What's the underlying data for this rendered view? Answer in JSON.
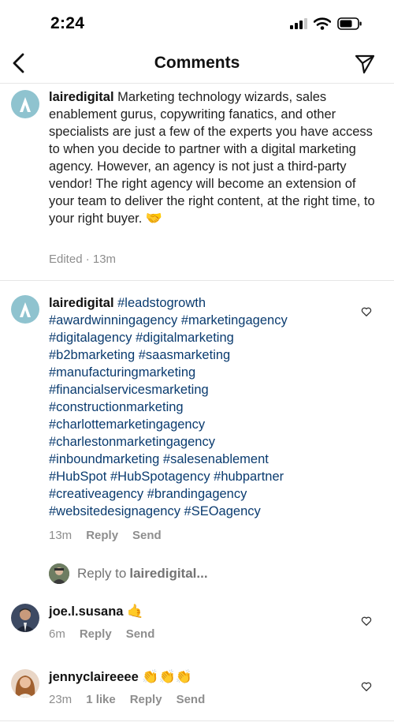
{
  "status_bar": {
    "time": "2:24"
  },
  "header": {
    "title": "Comments"
  },
  "caption": {
    "username": "lairedigital",
    "text": "Marketing technology wizards, sales enablement gurus, copywriting fanatics, and other specialists are just a few of the experts you have access to when you decide to partner with a digital marketing agency. However, an agency is not just a third-party vendor! The right agency will become an extension of your team to deliver the right content, at the right time, to your right buyer.",
    "emoji": "🤝",
    "meta": "Edited · 13m"
  },
  "comments": [
    {
      "username": "lairedigital",
      "lines": [
        "#leadstogrowth",
        "#awardwinningagency #marketingagency",
        "#digitalagency #digitalmarketing",
        "#b2bmarketing #saasmarketing",
        "#manufacturingmarketing",
        "#financialservicesmarketing",
        "#constructionmarketing",
        "#charlottemarketingagency",
        "#charlestonmarketingagency",
        "#inboundmarketing #salesenablement",
        "#HubSpot #HubSpotagency #hubpartner",
        "#creativeagency #brandingagency",
        "#websitedesignagency #SEOagency"
      ],
      "time": "13m",
      "reply_label": "Reply",
      "send_label": "Send"
    },
    {
      "username": "joe.l.susana",
      "emoji": "🤙",
      "time": "6m",
      "reply_label": "Reply",
      "send_label": "Send"
    },
    {
      "username": "jennyclaireeee",
      "emoji": "👏👏👏",
      "time": "23m",
      "likes": "1 like",
      "reply_label": "Reply",
      "send_label": "Send"
    }
  ],
  "reply_to": {
    "prefix": "Reply to",
    "username": "lairedigital..."
  },
  "colors": {
    "hashtag": "#0a3b6f",
    "meta": "#8e8e8e",
    "brand_avatar": "#8fc3cf"
  }
}
